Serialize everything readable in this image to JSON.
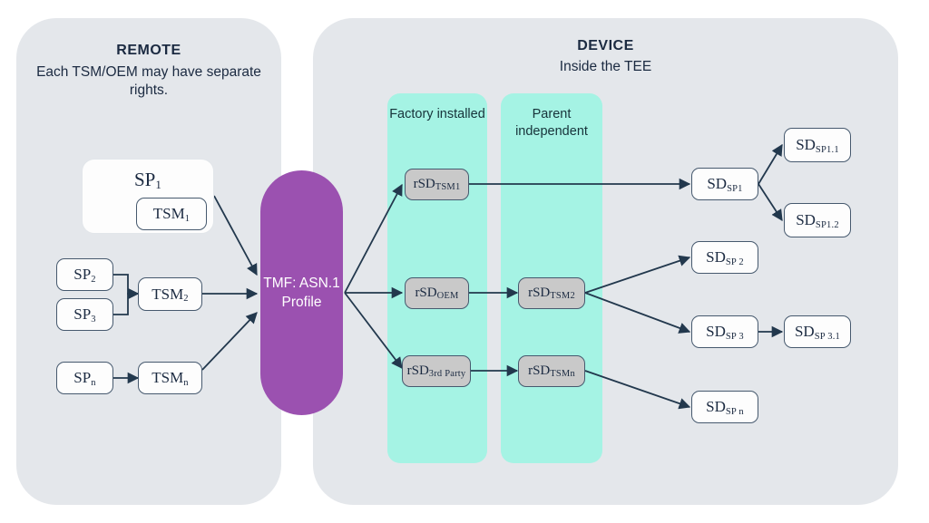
{
  "panels": {
    "remote": {
      "title": "REMOTE",
      "subtitle": "Each TSM/OEM may have separate rights."
    },
    "device": {
      "title": "DEVICE",
      "subtitle": "Inside the TEE"
    }
  },
  "columns": {
    "factory": "Factory installed",
    "parent": "Parent independent"
  },
  "pill": {
    "label": "TMF: ASN.1 Profile"
  },
  "remote_nodes": {
    "sp1": {
      "base": "SP",
      "sub": "1"
    },
    "tsm1": {
      "base": "TSM",
      "sub": "1"
    },
    "sp2": {
      "base": "SP",
      "sub": "2"
    },
    "sp3": {
      "base": "SP",
      "sub": "3"
    },
    "tsm2": {
      "base": "TSM",
      "sub": "2"
    },
    "spn": {
      "base": "SP",
      "sub": "n"
    },
    "tsmn": {
      "base": "TSM",
      "sub": "n"
    }
  },
  "device_nodes": {
    "rsd_tsm1": {
      "base": "rSD",
      "sub": "TSM1"
    },
    "rsd_oem": {
      "base": "rSD",
      "sub": "OEM"
    },
    "rsd_3rd": {
      "base": "rSD",
      "sub": "3rd Party"
    },
    "rsd_tsm2": {
      "base": "rSD",
      "sub": "TSM2"
    },
    "rsd_tsmn": {
      "base": "rSD",
      "sub": "TSMn"
    },
    "sd_sp1": {
      "base": "SD",
      "sub": "SP1"
    },
    "sd_sp1_1": {
      "base": "SD",
      "sub": "SP1.1"
    },
    "sd_sp1_2": {
      "base": "SD",
      "sub": "SP1.2"
    },
    "sd_sp2": {
      "base": "SD",
      "sub": "SP 2"
    },
    "sd_sp3": {
      "base": "SD",
      "sub": "SP 3"
    },
    "sd_sp3_1": {
      "base": "SD",
      "sub": "SP 3.1"
    },
    "sd_spn": {
      "base": "SD",
      "sub": "SP n"
    }
  },
  "colors": {
    "panel_bg": "#e4e7eb",
    "teal": "#a5f3e4",
    "purple": "#9b51b0",
    "gray_node": "#c9c9c9",
    "stroke": "#46596e",
    "text": "#1b2a41"
  }
}
